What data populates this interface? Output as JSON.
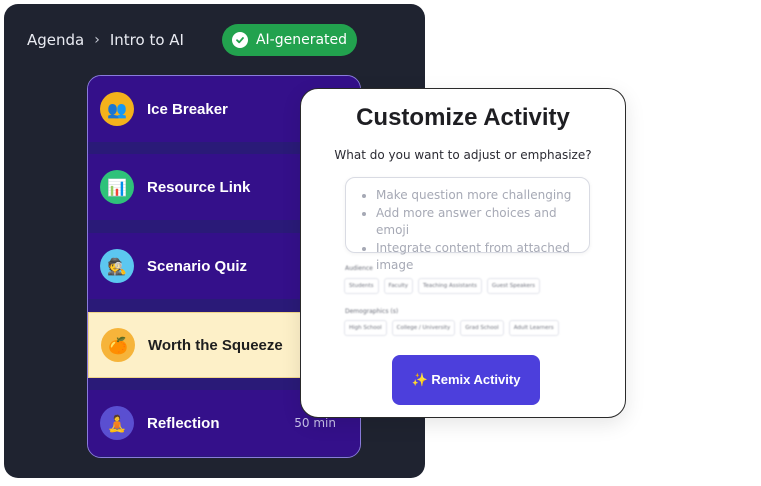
{
  "breadcrumb": {
    "root": "Agenda",
    "separator": "›",
    "current": "Intro to AI"
  },
  "ai_badge": {
    "label": "AI-generated",
    "color": "#22a24e",
    "icon": "check-circle-icon"
  },
  "activities": [
    {
      "label": "Ice Breaker",
      "emoji": "👥",
      "icon_bg": "#f4b21b",
      "meta": ""
    },
    {
      "label": "Resource Link",
      "emoji": "📊",
      "icon_bg": "#2fc27a",
      "meta": ""
    },
    {
      "label": "Scenario Quiz",
      "emoji": "🕵",
      "icon_bg": "#5cc7f0",
      "meta": ""
    },
    {
      "label": "Worth the Squeeze",
      "emoji": "🍊",
      "icon_bg": "#f6b43a",
      "meta": "",
      "selected": true
    },
    {
      "label": "Reflection",
      "emoji": "🧘",
      "icon_bg": "#5a4fd1",
      "meta": "50 min"
    }
  ],
  "modal": {
    "title": "Customize Activity",
    "question": "What do you want to adjust or emphasize?",
    "suggestions": [
      "Make question more challenging",
      "Add more answer choices and emoji",
      "Integrate content from attached image"
    ],
    "audience_label": "Audience",
    "audience_chips": [
      "Students",
      "Faculty",
      "Teaching Assistants",
      "Guest Speakers"
    ],
    "demographics_label": "Demographics (s)",
    "demographics_chips": [
      "High School",
      "College / University",
      "Grad School",
      "Adult Learners"
    ],
    "remix_label": "✨ Remix Activity",
    "accent": "#4c3fdc"
  }
}
